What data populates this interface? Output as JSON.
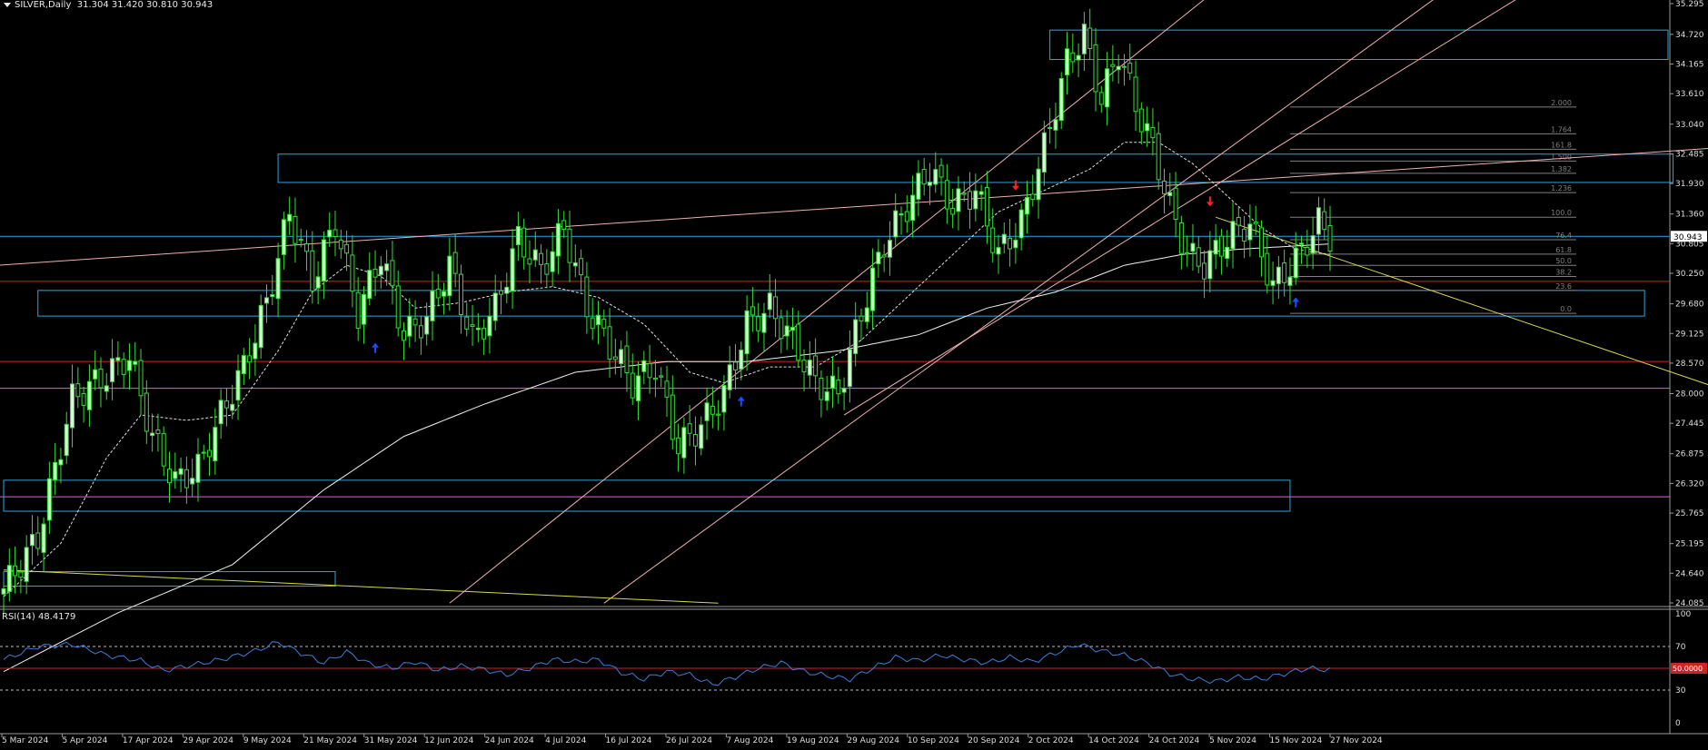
{
  "header": {
    "symbol": "SILVER,Daily",
    "ohlc": "31.304 31.420 30.810 30.943"
  },
  "colors": {
    "background": "#000000",
    "bull_candle": "#ccffcc",
    "bear_candle": "#33dd33",
    "zone_box": "#2aa6e0",
    "sr_red": "#d12222",
    "sr_magenta": "#e060e0",
    "channel": "#f0b0b0",
    "trend_yellow": "#d8d850",
    "ma_fast": "#e0e0e0",
    "ma_slow": "#f0f0f0",
    "rsi_line": "#3a7fd8",
    "fib": "#808080"
  },
  "chart_data": [
    {
      "type": "candlestick",
      "title": "SILVER,Daily",
      "last_price": "30.943",
      "y_ticks": [
        "35.295",
        "34.720",
        "34.165",
        "33.610",
        "33.040",
        "32.485",
        "31.930",
        "31.360",
        "30.805",
        "30.250",
        "29.680",
        "29.125",
        "28.570",
        "28.000",
        "27.445",
        "26.875",
        "26.320",
        "25.765",
        "25.195",
        "24.640",
        "24.085"
      ],
      "x_ticks": [
        "5 Mar 2024",
        "5 Apr 2024",
        "17 Apr 2024",
        "29 Apr 2024",
        "9 May 2024",
        "21 May 2024",
        "31 May 2024",
        "12 Jun 2024",
        "24 Jun 2024",
        "4 Jul 2024",
        "16 Jul 2024",
        "26 Jul 2024",
        "7 Aug 2024",
        "19 Aug 2024",
        "29 Aug 2024",
        "10 Sep 2024",
        "20 Sep 2024",
        "2 Oct 2024",
        "14 Oct 2024",
        "24 Oct 2024",
        "5 Nov 2024",
        "15 Nov 2024",
        "27 Nov 2024"
      ],
      "ylim": [
        24.085,
        35.295
      ],
      "close_path_anchors": [
        {
          "bar": 0,
          "close": 24.35
        },
        {
          "bar": 6,
          "close": 25.3
        },
        {
          "bar": 12,
          "close": 27.9
        },
        {
          "bar": 18,
          "close": 28.35
        },
        {
          "bar": 22,
          "close": 28.7
        },
        {
          "bar": 26,
          "close": 27.2
        },
        {
          "bar": 30,
          "close": 26.35
        },
        {
          "bar": 34,
          "close": 26.6
        },
        {
          "bar": 38,
          "close": 27.6
        },
        {
          "bar": 42,
          "close": 28.5
        },
        {
          "bar": 46,
          "close": 29.7
        },
        {
          "bar": 50,
          "close": 31.4
        },
        {
          "bar": 54,
          "close": 30.1
        },
        {
          "bar": 58,
          "close": 31.2
        },
        {
          "bar": 62,
          "close": 29.5
        },
        {
          "bar": 66,
          "close": 30.6
        },
        {
          "bar": 70,
          "close": 29.1
        },
        {
          "bar": 74,
          "close": 29.4
        },
        {
          "bar": 78,
          "close": 30.4
        },
        {
          "bar": 82,
          "close": 29.0
        },
        {
          "bar": 86,
          "close": 29.6
        },
        {
          "bar": 90,
          "close": 30.9
        },
        {
          "bar": 94,
          "close": 30.3
        },
        {
          "bar": 98,
          "close": 31.1
        },
        {
          "bar": 102,
          "close": 29.6
        },
        {
          "bar": 106,
          "close": 28.9
        },
        {
          "bar": 110,
          "close": 28.2
        },
        {
          "bar": 114,
          "close": 28.5
        },
        {
          "bar": 118,
          "close": 27.0
        },
        {
          "bar": 122,
          "close": 27.4
        },
        {
          "bar": 126,
          "close": 28.0
        },
        {
          "bar": 130,
          "close": 29.3
        },
        {
          "bar": 134,
          "close": 29.6
        },
        {
          "bar": 138,
          "close": 29.0
        },
        {
          "bar": 142,
          "close": 28.2
        },
        {
          "bar": 146,
          "close": 28.0
        },
        {
          "bar": 150,
          "close": 29.5
        },
        {
          "bar": 154,
          "close": 30.8
        },
        {
          "bar": 158,
          "close": 31.5
        },
        {
          "bar": 162,
          "close": 32.2
        },
        {
          "bar": 166,
          "close": 31.5
        },
        {
          "bar": 170,
          "close": 31.8
        },
        {
          "bar": 174,
          "close": 30.6
        },
        {
          "bar": 178,
          "close": 31.2
        },
        {
          "bar": 182,
          "close": 32.6
        },
        {
          "bar": 186,
          "close": 34.2
        },
        {
          "bar": 189,
          "close": 34.7
        },
        {
          "bar": 192,
          "close": 33.5
        },
        {
          "bar": 195,
          "close": 34.4
        },
        {
          "bar": 198,
          "close": 33.4
        },
        {
          "bar": 201,
          "close": 32.6
        },
        {
          "bar": 204,
          "close": 31.5
        },
        {
          "bar": 207,
          "close": 30.6
        },
        {
          "bar": 210,
          "close": 30.4
        },
        {
          "bar": 214,
          "close": 30.9
        },
        {
          "bar": 218,
          "close": 31.2
        },
        {
          "bar": 222,
          "close": 30.0
        },
        {
          "bar": 226,
          "close": 30.5
        },
        {
          "bar": 230,
          "close": 31.2
        },
        {
          "bar": 232,
          "close": 30.943
        }
      ],
      "bar_count": 233,
      "series": [
        {
          "name": "ma_fast",
          "kind": "dashed",
          "anchors": [
            {
              "bar": 0,
              "v": 24.2
            },
            {
              "bar": 10,
              "v": 25.2
            },
            {
              "bar": 18,
              "v": 26.8
            },
            {
              "bar": 24,
              "v": 27.6
            },
            {
              "bar": 32,
              "v": 27.5
            },
            {
              "bar": 40,
              "v": 27.6
            },
            {
              "bar": 48,
              "v": 28.8
            },
            {
              "bar": 54,
              "v": 29.9
            },
            {
              "bar": 60,
              "v": 30.4
            },
            {
              "bar": 66,
              "v": 30.2
            },
            {
              "bar": 72,
              "v": 29.6
            },
            {
              "bar": 80,
              "v": 29.7
            },
            {
              "bar": 88,
              "v": 29.9
            },
            {
              "bar": 96,
              "v": 30.0
            },
            {
              "bar": 104,
              "v": 29.8
            },
            {
              "bar": 112,
              "v": 29.3
            },
            {
              "bar": 120,
              "v": 28.4
            },
            {
              "bar": 126,
              "v": 28.2
            },
            {
              "bar": 134,
              "v": 28.5
            },
            {
              "bar": 142,
              "v": 28.5
            },
            {
              "bar": 150,
              "v": 29.0
            },
            {
              "bar": 158,
              "v": 29.8
            },
            {
              "bar": 166,
              "v": 30.6
            },
            {
              "bar": 174,
              "v": 31.4
            },
            {
              "bar": 182,
              "v": 31.8
            },
            {
              "bar": 190,
              "v": 32.2
            },
            {
              "bar": 196,
              "v": 32.7
            },
            {
              "bar": 202,
              "v": 32.7
            },
            {
              "bar": 208,
              "v": 32.3
            },
            {
              "bar": 214,
              "v": 31.7
            },
            {
              "bar": 220,
              "v": 31.1
            },
            {
              "bar": 226,
              "v": 30.7
            },
            {
              "bar": 232,
              "v": 30.6
            }
          ]
        },
        {
          "name": "ma_slow",
          "kind": "solid",
          "anchors": [
            {
              "bar": 0,
              "v": 22.8
            },
            {
              "bar": 20,
              "v": 23.9
            },
            {
              "bar": 40,
              "v": 24.8
            },
            {
              "bar": 56,
              "v": 26.2
            },
            {
              "bar": 70,
              "v": 27.2
            },
            {
              "bar": 84,
              "v": 27.8
            },
            {
              "bar": 100,
              "v": 28.4
            },
            {
              "bar": 116,
              "v": 28.6
            },
            {
              "bar": 130,
              "v": 28.6
            },
            {
              "bar": 146,
              "v": 28.8
            },
            {
              "bar": 160,
              "v": 29.1
            },
            {
              "bar": 172,
              "v": 29.6
            },
            {
              "bar": 184,
              "v": 29.9
            },
            {
              "bar": 196,
              "v": 30.4
            },
            {
              "bar": 206,
              "v": 30.6
            },
            {
              "bar": 216,
              "v": 30.7
            },
            {
              "bar": 232,
              "v": 30.8
            }
          ]
        }
      ],
      "zones": [
        {
          "name": "zone-top",
          "y_top": 34.8,
          "y_bottom": 34.25,
          "x_from_bar": 183,
          "x_to": "edge"
        },
        {
          "name": "zone-upper",
          "y_top": 32.48,
          "y_bottom": 31.95,
          "x_from_bar": 48,
          "x_to_bar": 292
        },
        {
          "name": "zone-mid",
          "y_top": 29.93,
          "y_bottom": 29.45,
          "x_from_bar": 6,
          "x_to_bar": 287
        },
        {
          "name": "zone-low",
          "y_top": 26.38,
          "y_bottom": 25.8,
          "x_from_bar": 0,
          "x_to_bar": 225
        },
        {
          "name": "zone-bottom",
          "y_top": 24.67,
          "y_bottom": 24.4,
          "x_from_bar": 0,
          "x_to_bar": 58
        }
      ],
      "hlines": [
        {
          "name": "sr-red-upper",
          "y": 30.1,
          "color": "sr_red"
        },
        {
          "name": "sr-red-lower",
          "y": 28.6,
          "color": "sr_red"
        },
        {
          "name": "sr-magenta-upper",
          "y": 28.1,
          "color": "sr_magenta"
        },
        {
          "name": "sr-magenta-lower",
          "y": 26.07,
          "color": "sr_magenta"
        },
        {
          "name": "last-price-line",
          "y": 30.943,
          "color": "zone_box"
        }
      ],
      "fib_levels": [
        {
          "label": "2.000",
          "y": 33.36
        },
        {
          "label": "1.764",
          "y": 32.86
        },
        {
          "label": "161.8",
          "y": 32.57
        },
        {
          "label": "1.500",
          "y": 32.35
        },
        {
          "label": "1.382",
          "y": 32.12
        },
        {
          "label": "1.236",
          "y": 31.76
        },
        {
          "label": "100.0",
          "y": 31.3
        },
        {
          "label": "76.4",
          "y": 30.88
        },
        {
          "label": "61.8",
          "y": 30.61
        },
        {
          "label": "50.0",
          "y": 30.4
        },
        {
          "label": "38.2",
          "y": 30.19
        },
        {
          "label": "23.6",
          "y": 29.93
        },
        {
          "label": "0.0",
          "y": 29.5
        }
      ],
      "fib_from_bar": 225,
      "rsi": {
        "title": "RSI(14) 48.4179",
        "value": 48.4179,
        "y_ticks": [
          "100",
          "70",
          "50.0000",
          "30",
          "0"
        ],
        "levels": [
          70,
          50,
          30
        ],
        "anchors": [
          {
            "bar": 0,
            "v": 58
          },
          {
            "bar": 6,
            "v": 70
          },
          {
            "bar": 12,
            "v": 72
          },
          {
            "bar": 18,
            "v": 62
          },
          {
            "bar": 24,
            "v": 57
          },
          {
            "bar": 28,
            "v": 48
          },
          {
            "bar": 32,
            "v": 52
          },
          {
            "bar": 38,
            "v": 58
          },
          {
            "bar": 44,
            "v": 66
          },
          {
            "bar": 48,
            "v": 74
          },
          {
            "bar": 52,
            "v": 64
          },
          {
            "bar": 56,
            "v": 55
          },
          {
            "bar": 60,
            "v": 65
          },
          {
            "bar": 64,
            "v": 54
          },
          {
            "bar": 68,
            "v": 50
          },
          {
            "bar": 72,
            "v": 56
          },
          {
            "bar": 76,
            "v": 48
          },
          {
            "bar": 80,
            "v": 52
          },
          {
            "bar": 84,
            "v": 49
          },
          {
            "bar": 88,
            "v": 44
          },
          {
            "bar": 92,
            "v": 50
          },
          {
            "bar": 96,
            "v": 58
          },
          {
            "bar": 100,
            "v": 56
          },
          {
            "bar": 104,
            "v": 58
          },
          {
            "bar": 108,
            "v": 46
          },
          {
            "bar": 112,
            "v": 40
          },
          {
            "bar": 116,
            "v": 47
          },
          {
            "bar": 120,
            "v": 44
          },
          {
            "bar": 124,
            "v": 35
          },
          {
            "bar": 128,
            "v": 42
          },
          {
            "bar": 132,
            "v": 50
          },
          {
            "bar": 136,
            "v": 55
          },
          {
            "bar": 140,
            "v": 47
          },
          {
            "bar": 144,
            "v": 43
          },
          {
            "bar": 148,
            "v": 40
          },
          {
            "bar": 152,
            "v": 50
          },
          {
            "bar": 156,
            "v": 60
          },
          {
            "bar": 160,
            "v": 57
          },
          {
            "bar": 164,
            "v": 62
          },
          {
            "bar": 168,
            "v": 58
          },
          {
            "bar": 172,
            "v": 55
          },
          {
            "bar": 176,
            "v": 60
          },
          {
            "bar": 180,
            "v": 56
          },
          {
            "bar": 184,
            "v": 64
          },
          {
            "bar": 188,
            "v": 72
          },
          {
            "bar": 192,
            "v": 66
          },
          {
            "bar": 196,
            "v": 62
          },
          {
            "bar": 200,
            "v": 55
          },
          {
            "bar": 204,
            "v": 45
          },
          {
            "bar": 208,
            "v": 40
          },
          {
            "bar": 212,
            "v": 38
          },
          {
            "bar": 216,
            "v": 42
          },
          {
            "bar": 220,
            "v": 40
          },
          {
            "bar": 224,
            "v": 45
          },
          {
            "bar": 228,
            "v": 50
          },
          {
            "bar": 232,
            "v": 48.4
          }
        ]
      }
    }
  ]
}
